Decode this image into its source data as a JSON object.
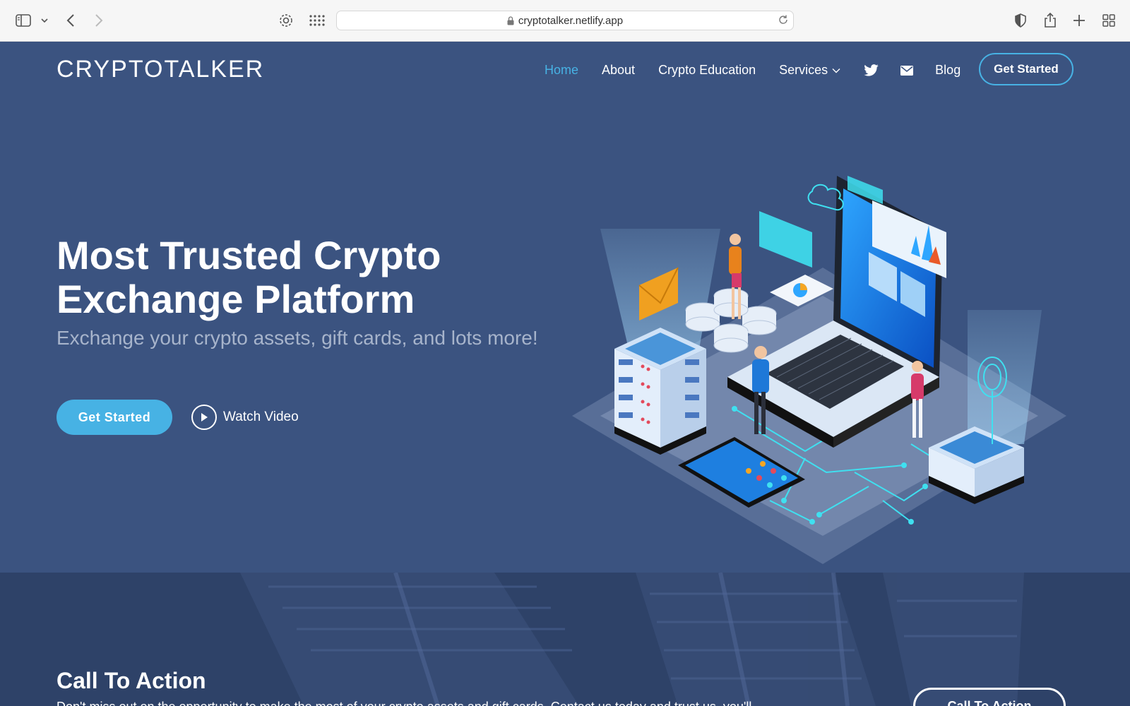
{
  "browser": {
    "url": "cryptotalker.netlify.app",
    "icons": [
      "sidebar-icon",
      "chevron-down-icon",
      "back-icon",
      "forward-icon",
      "gear-icon",
      "grid-icon",
      "lock-icon",
      "reload-icon",
      "shield-icon",
      "share-icon",
      "plus-icon",
      "tabs-overview-icon"
    ]
  },
  "site": {
    "logo": "CRYPTOTALKER",
    "nav": {
      "home": "Home",
      "about": "About",
      "education": "Crypto Education",
      "services": "Services",
      "blog": "Blog",
      "get_started": "Get Started"
    },
    "colors": {
      "accent": "#47b2e4",
      "hero_bg": "#3b5380",
      "cta_bg": "#2c3f63"
    }
  },
  "hero": {
    "title": "Most Trusted Crypto Exchange Platform",
    "subtitle": "Exchange your crypto assets, gift cards, and lots more!",
    "get_started": "Get Started",
    "watch_video": "Watch Video"
  },
  "cta": {
    "title": "Call To Action",
    "text": "Don't miss out on the opportunity to make the most of your crypto assets and gift cards. Contact us today and trust us, you'll",
    "button": "Call To Action"
  }
}
